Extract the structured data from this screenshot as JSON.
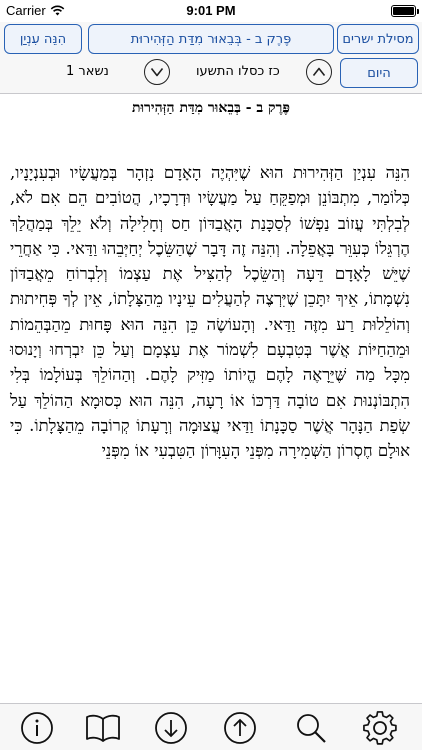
{
  "status_bar": {
    "carrier": "Carrier",
    "time": "9:01 PM"
  },
  "header": {
    "book_button": "מסילת ישרים",
    "chapter_select": "פֶּרֶק ב - בְּבֵאוּר מִדַּת הַזְּהִירוּת",
    "topic_button": "הִנֵּה עִנְיַן",
    "today_button": "היום",
    "date": "כז כסלו התשעו",
    "remaining": "נשאר 1"
  },
  "chapter_title": "פֶּרֶק ב - בְּבֵאוּר מִדַּת הַזְּהִירוּת",
  "body_text": "הִנֵּה עִנְיַן הַזְּהִירוּת הוּא שֶׁיִּהְיֶה הָאָדָם נִזְהָר בְּמַעֲשָׂיו וּבְעִנְיָנָיו, כְּלוֹמַר, מִתְבּוֹנֵן וּמְפַקֵּחַ עַל מַעֲשָׂיו וּדְרָכָיו, הֲטוֹבִים הֵם אִם לֹא, לְבִלְתִּי עֲזוֹב נַפְשׁוֹ לְסַכָּנַת הָאֲבַדּוֹן חַס וְחָלִילָה וְלֹא יֵלֵךְ בְּמַהֲלַךְ הֶרְגֵּלוֹ כְּעִוֵּר בָּאֲפֵלָה. וְהִנֵּה זֶה דָּבָר שֶׁהַשֵּׂכֶל יְחַיְּבֵהוּ וַדַּאי. כִּי אַחֲרֵי שֶׁיֵּשׁ לָאָדָם דֵּעָה וְהַשֵּׂכֶל לְהַצִּיל אֶת עַצְמוֹ וְלִבְרוֹחַ מֵאֲבַדּוֹן נִשְׁמָתוֹ, אֵיךְ יִתָּכֵן שֶׁיִּרְצֶה לְהַעֲלִים עֵינָיו מֵהַצָּלָתוֹ, אֵין לְךָ פְּחִיתוּת וְהוֹלֵלוּת רַע מִזֶּה וַדַּאי. וְהָעוֹשֶׂה כֵּן הִנֵּה הוּא פָּחוּת מֵהַבְּהֵמוֹת וּמֵהַחַיּוֹת אֲשֶׁר בְּטִבְעָם לִשְׁמוֹר אֶת עַצְמָם וְעַל כֵּן יִבְרְחוּ וְיָנוּסוּ מִכָּל מַה שֶּׁיֵּרָאֶה לָהֶם הֱיוֹתוֹ מַזִּיק לָהֶם. וְהַהוֹלֵךְ בְּעוֹלָמוֹ בְּלִי הִתְבּוֹנְנוּת אִם טוֹבָה דַּרְכּוֹ אוֹ רָעָה, הִנֵּה הוּא כְּסוּמָא הַהוֹלֵךְ עַל שְׂפַת הַנָּהָר אֲשֶׁר סַכָּנָתוֹ וַדַּאי עֲצוּמָה וְרָעָתוֹ קְרוֹבָה מֵהַצָּלָתוֹ. כִּי אוּלָם חֶסְרוֹן הַשְּׁמִירָה מִפְּנֵי הָעִוָּרוֹן הַטִּבְעִי אוֹ מִפְּנֵי",
  "toolbar": {
    "icons": [
      "info-icon",
      "book-icon",
      "arrow-down-icon",
      "arrow-up-icon",
      "search-icon",
      "gear-icon"
    ]
  },
  "colors": {
    "accent": "#1a4ea0",
    "button_border": "#2962b5",
    "button_bg": "#eef3fb"
  }
}
